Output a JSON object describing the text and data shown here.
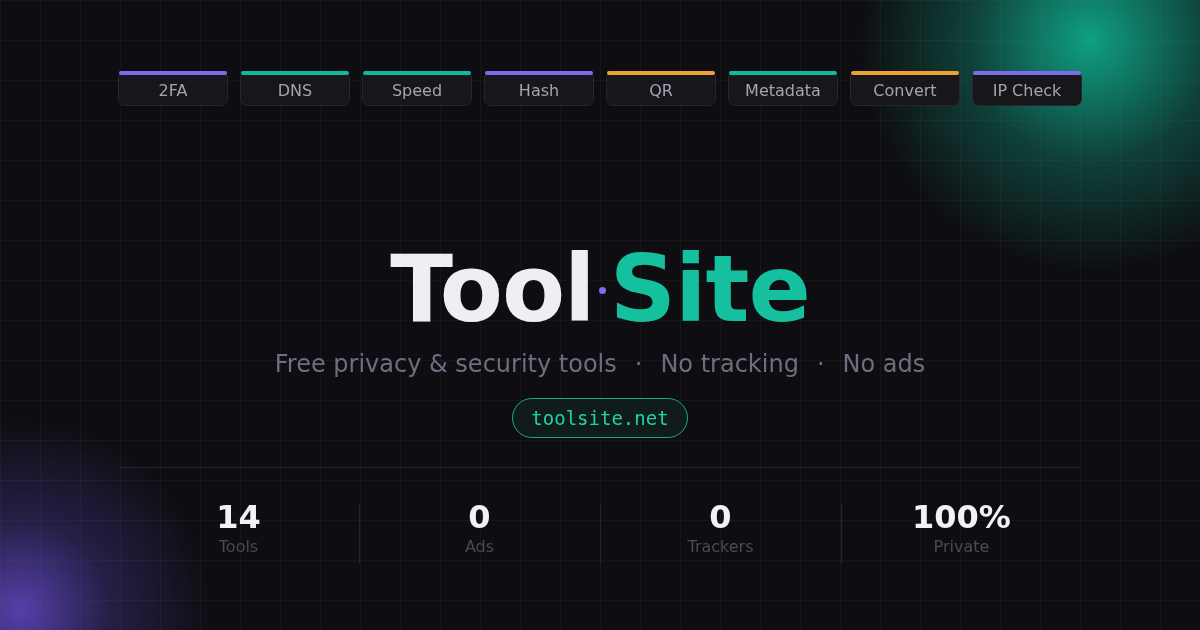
{
  "tags": [
    {
      "label": "2FA",
      "color": "#7c6cf0"
    },
    {
      "label": "DNS",
      "color": "#14b8a0"
    },
    {
      "label": "Speed",
      "color": "#14b8a0"
    },
    {
      "label": "Hash",
      "color": "#7c6cf0"
    },
    {
      "label": "QR",
      "color": "#f0a030"
    },
    {
      "label": "Metadata",
      "color": "#14b8a0"
    },
    {
      "label": "Convert",
      "color": "#f0a030"
    },
    {
      "label": "IP Check",
      "color": "#7c6cf0"
    }
  ],
  "logo": {
    "first": "Tool",
    "second": "Site"
  },
  "tagline": [
    {
      "text": "Free privacy & security tools"
    },
    {
      "text": "·"
    },
    {
      "text": "No tracking"
    },
    {
      "text": "·"
    },
    {
      "text": "No ads"
    }
  ],
  "url": "toolsite.net",
  "stats": [
    {
      "value": "14",
      "label": "Tools"
    },
    {
      "value": "0",
      "label": "Ads"
    },
    {
      "value": "0",
      "label": "Trackers"
    },
    {
      "value": "100%",
      "label": "Private"
    }
  ]
}
